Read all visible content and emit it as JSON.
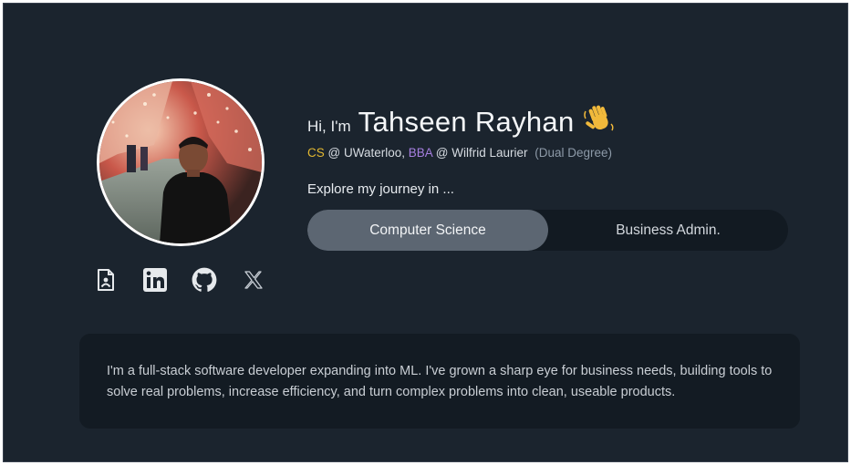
{
  "profile": {
    "greeting": "Hi, I'm",
    "name": "Tahseen Rayhan",
    "wave_emoji": "👋",
    "degrees": {
      "cs_label": "CS",
      "cs_school": " @ UWaterloo, ",
      "bba_label": "BBA",
      "bba_school": " @ Wilfrid Laurier ",
      "dual_note": "(Dual Degree)"
    },
    "explore_prompt": "Explore my journey in ..."
  },
  "toggle": {
    "options": [
      {
        "label": "Computer Science",
        "active": true
      },
      {
        "label": "Business Admin.",
        "active": false
      }
    ]
  },
  "social": {
    "icons": [
      "resume-file-icon",
      "linkedin-icon",
      "github-icon",
      "x-twitter-icon"
    ]
  },
  "bio": {
    "text": "I'm a full-stack software developer expanding into ML. I've grown a sharp eye for business needs, building tools to solve real problems, increase efficiency, and turn complex problems into clean, useable products."
  },
  "colors": {
    "background": "#1b242e",
    "card": "#131b23",
    "toggle_active": "#5c6672",
    "cs_accent": "#e3b830",
    "bba_accent": "#a67fe0"
  }
}
